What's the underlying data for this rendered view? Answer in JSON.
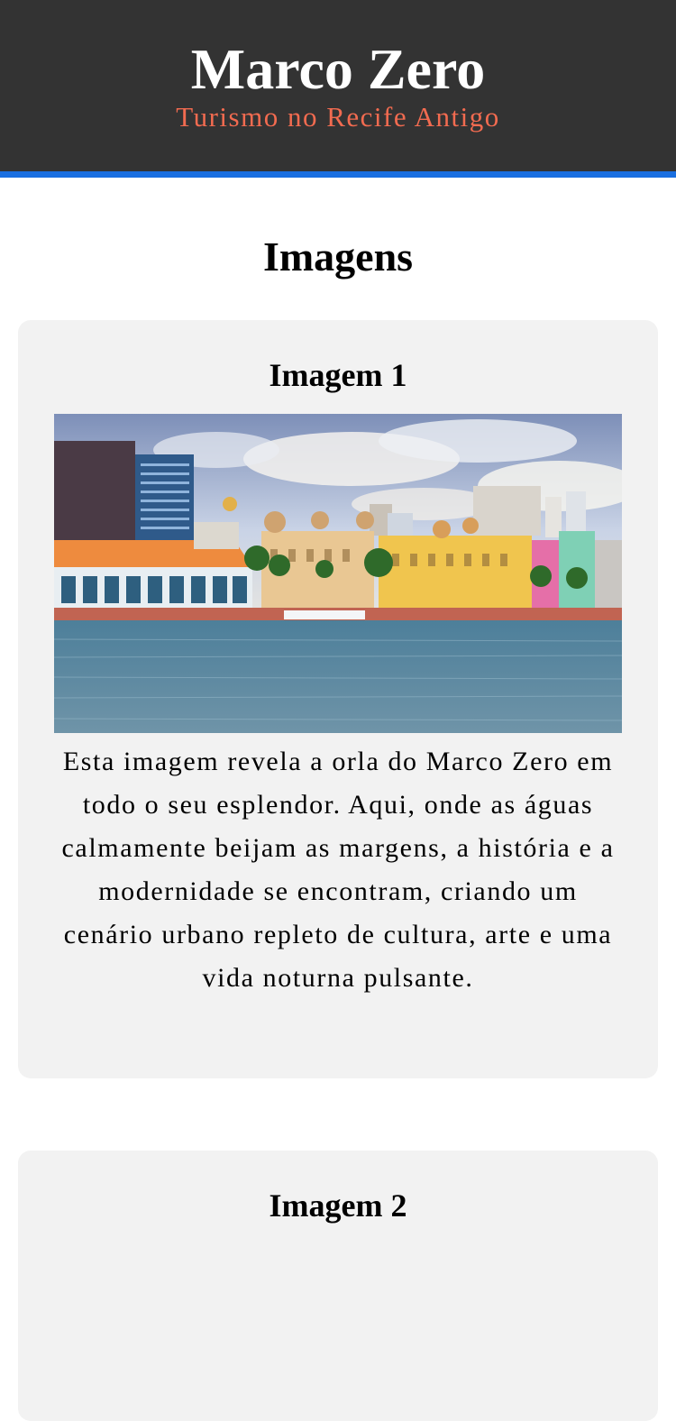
{
  "header": {
    "title": "Marco Zero",
    "subtitle": "Turismo no Recife Antigo",
    "accent_color": "#1a6fe0",
    "subtitle_color": "#f26b50"
  },
  "main": {
    "section_title": "Imagens",
    "cards": [
      {
        "title": "Imagem 1",
        "image_icon": "recife-waterfront-photo",
        "text": "Esta imagem revela a orla do Marco Zero em todo o seu esplendor. Aqui, onde as águas calmamente beijam as margens, a história e a modernidade se encontram, criando um cenário urbano repleto de cultura, arte e uma vida noturna pulsante."
      },
      {
        "title": "Imagem 2"
      }
    ]
  }
}
